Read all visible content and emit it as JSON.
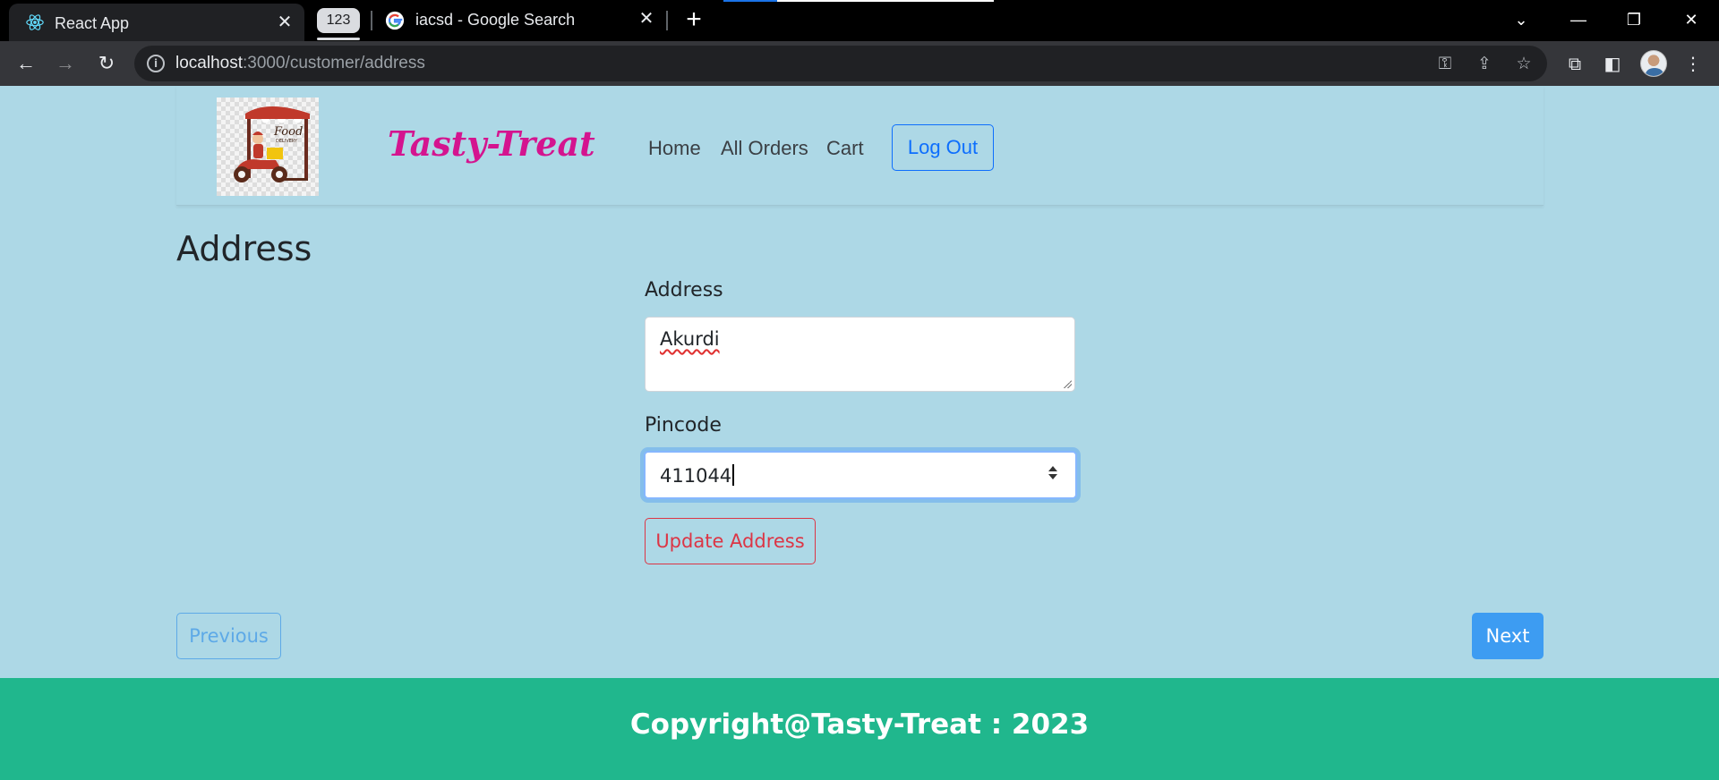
{
  "browser": {
    "tabs": [
      {
        "title": "React App",
        "active": true,
        "icon": "react-icon"
      },
      {
        "title": "iacsd - Google Search",
        "active": false,
        "icon": "google-icon"
      }
    ],
    "tab_group_label": "123",
    "url_host": "localhost",
    "url_path": ":3000/customer/address",
    "colors": {
      "tabbar": "#000000",
      "toolbar": "#35363a",
      "omnibox": "#202124"
    }
  },
  "navbar": {
    "brand": "Tasty-Treat",
    "logo_text": "Food",
    "logo_subtext": "DELIVERY",
    "links": [
      "Home",
      "All Orders",
      "Cart"
    ],
    "logout_label": "Log Out"
  },
  "main": {
    "heading": "Address",
    "address_label": "Address",
    "address_value": "Akurdi",
    "pincode_label": "Pincode",
    "pincode_value": "411044",
    "update_button": "Update Address"
  },
  "pager": {
    "previous": "Previous",
    "next": "Next"
  },
  "footer": {
    "text": "Copyright@Tasty-Treat : 2023"
  },
  "colors": {
    "page_bg": "#add8e6",
    "brand": "#d4148f",
    "footer_bg": "#20b78d",
    "primary": "#0d6efd",
    "danger": "#dc3545",
    "next_bg": "#3d9cf2"
  }
}
